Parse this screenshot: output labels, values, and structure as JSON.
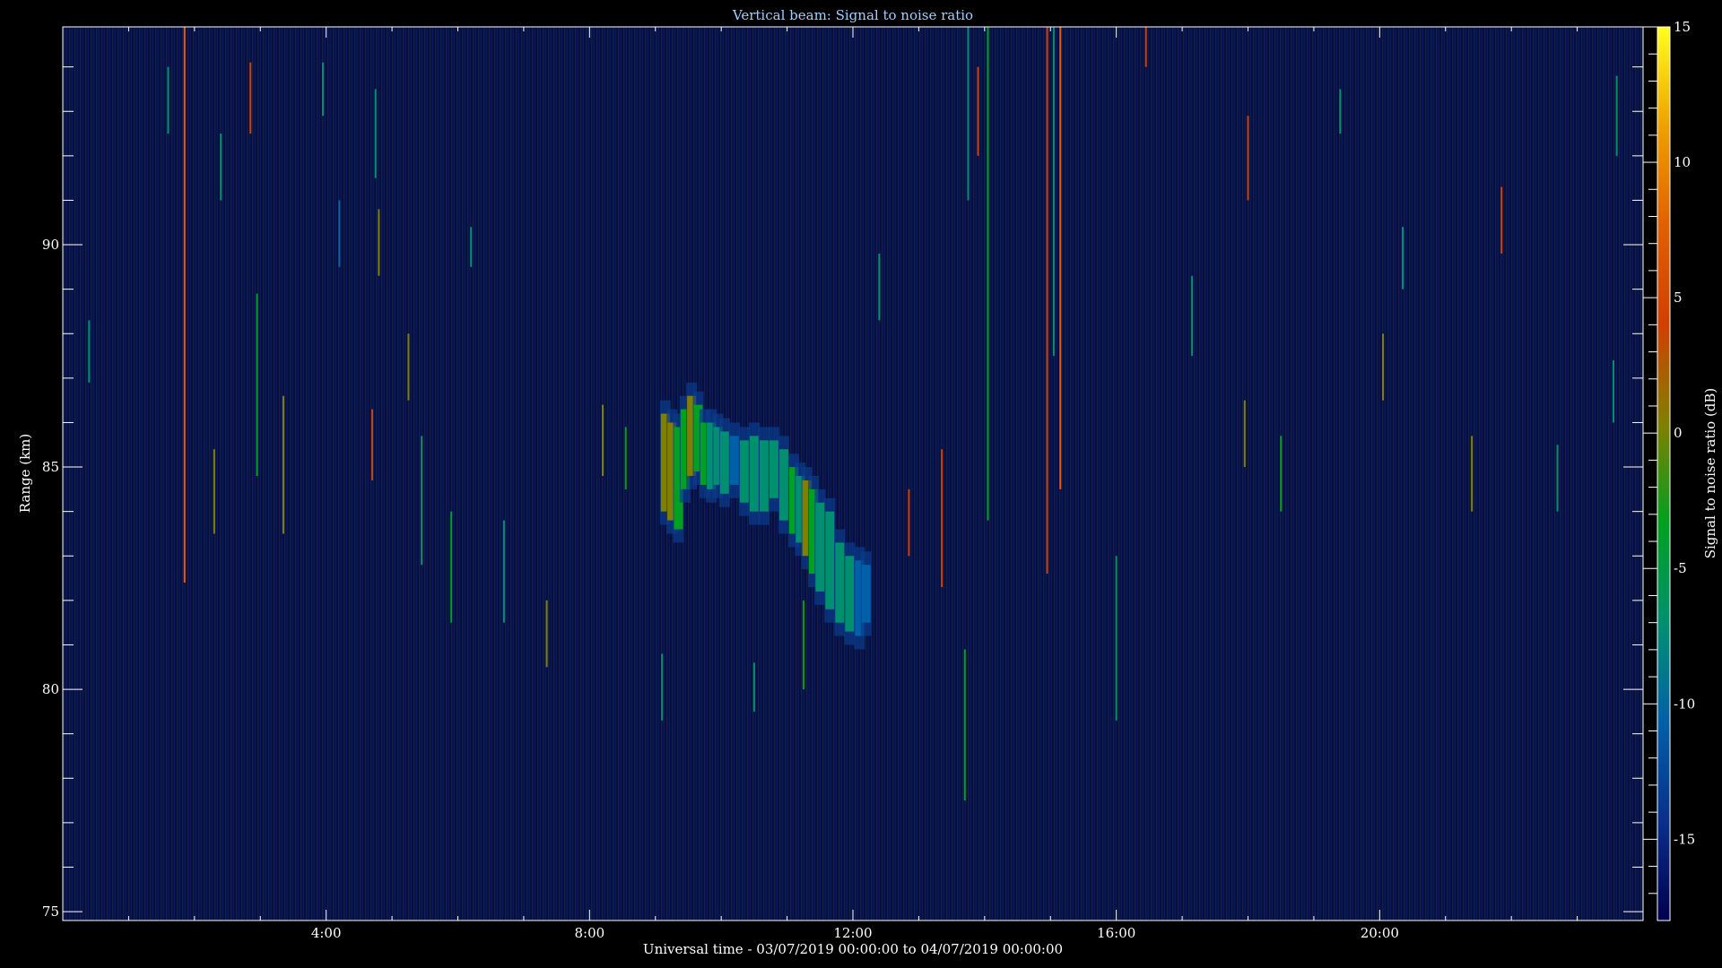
{
  "chart_data": {
    "type": "heatmap",
    "title": "Vertical beam: Signal to noise ratio",
    "xlabel": "Universal time - 03/07/2019 00:00:00 to 04/07/2019 00:00:00",
    "ylabel": "Range (km)",
    "colorbar_label": "Signal to noise ratio (dB)",
    "xlim": [
      0,
      24
    ],
    "ylim": [
      74.8,
      94.9
    ],
    "clim": [
      -18,
      15
    ],
    "x_ticks": [
      {
        "value": 4,
        "label": "4:00"
      },
      {
        "value": 8,
        "label": "8:00"
      },
      {
        "value": 12,
        "label": "12:00"
      },
      {
        "value": 16,
        "label": "16:00"
      },
      {
        "value": 20,
        "label": "20:00"
      }
    ],
    "y_ticks": [
      {
        "value": 75,
        "label": "75"
      },
      {
        "value": 80,
        "label": "80"
      },
      {
        "value": 85,
        "label": "85"
      },
      {
        "value": 90,
        "label": "90"
      }
    ],
    "colorbar_ticks": [
      {
        "value": 15,
        "label": "15"
      },
      {
        "value": 10,
        "label": "10"
      },
      {
        "value": 5,
        "label": "5"
      },
      {
        "value": 0,
        "label": "0"
      },
      {
        "value": -5,
        "label": "-5"
      },
      {
        "value": -10,
        "label": "-10"
      },
      {
        "value": -15,
        "label": "-15"
      }
    ],
    "colormap": [
      "#00004f",
      "#0a2f8c",
      "#0060a8",
      "#009070",
      "#00a020",
      "#808000",
      "#d04000",
      "#e06000",
      "#f0a000",
      "#ffff20"
    ],
    "background_color": "#0a0f3c",
    "echo_region": {
      "time_start": 9.1,
      "time_end": 12.3,
      "range_top": 86.5,
      "range_bottom": 81.2,
      "peak_snr": 2
    },
    "echo_cells": [
      {
        "t": 9.15,
        "r_top": 86.2,
        "r_bottom": 84.0,
        "snr": 1
      },
      {
        "t": 9.25,
        "r_top": 86.0,
        "r_bottom": 83.8,
        "snr": 0
      },
      {
        "t": 9.35,
        "r_top": 85.9,
        "r_bottom": 83.6,
        "snr": -4
      },
      {
        "t": 9.45,
        "r_top": 86.3,
        "r_bottom": 84.5,
        "snr": -5
      },
      {
        "t": 9.55,
        "r_top": 86.6,
        "r_bottom": 84.8,
        "snr": 1
      },
      {
        "t": 9.65,
        "r_top": 86.4,
        "r_bottom": 84.9,
        "snr": -2
      },
      {
        "t": 9.75,
        "r_top": 86.0,
        "r_bottom": 84.6,
        "snr": -5
      },
      {
        "t": 9.85,
        "r_top": 86.0,
        "r_bottom": 84.5,
        "snr": -7
      },
      {
        "t": 9.95,
        "r_top": 85.9,
        "r_bottom": 84.6,
        "snr": -7
      },
      {
        "t": 10.05,
        "r_top": 85.8,
        "r_bottom": 84.4,
        "snr": -8
      },
      {
        "t": 10.2,
        "r_top": 85.7,
        "r_bottom": 84.6,
        "snr": -9
      },
      {
        "t": 10.35,
        "r_top": 85.6,
        "r_bottom": 84.2,
        "snr": -7
      },
      {
        "t": 10.5,
        "r_top": 85.7,
        "r_bottom": 84.0,
        "snr": -8
      },
      {
        "t": 10.65,
        "r_top": 85.6,
        "r_bottom": 84.0,
        "snr": -7
      },
      {
        "t": 10.8,
        "r_top": 85.6,
        "r_bottom": 84.3,
        "snr": -6
      },
      {
        "t": 10.95,
        "r_top": 85.4,
        "r_bottom": 83.8,
        "snr": -7
      },
      {
        "t": 11.1,
        "r_top": 85.0,
        "r_bottom": 83.5,
        "snr": -5
      },
      {
        "t": 11.2,
        "r_top": 84.8,
        "r_bottom": 83.3,
        "snr": -6
      },
      {
        "t": 11.3,
        "r_top": 84.7,
        "r_bottom": 83.0,
        "snr": 1
      },
      {
        "t": 11.4,
        "r_top": 84.5,
        "r_bottom": 82.6,
        "snr": -5
      },
      {
        "t": 11.5,
        "r_top": 84.2,
        "r_bottom": 82.2,
        "snr": -6
      },
      {
        "t": 11.65,
        "r_top": 84.0,
        "r_bottom": 81.8,
        "snr": -7
      },
      {
        "t": 11.8,
        "r_top": 83.3,
        "r_bottom": 81.5,
        "snr": -6
      },
      {
        "t": 11.95,
        "r_top": 83.0,
        "r_bottom": 81.3,
        "snr": -8
      },
      {
        "t": 12.1,
        "r_top": 82.9,
        "r_bottom": 81.2,
        "snr": -9
      },
      {
        "t": 12.2,
        "r_top": 82.8,
        "r_bottom": 81.5,
        "snr": -11
      }
    ],
    "noise_streaks": [
      {
        "t": 0.4,
        "r_top": 88.3,
        "r_bottom": 86.9,
        "snr": -8
      },
      {
        "t": 1.6,
        "r_top": 94.0,
        "r_bottom": 92.5,
        "snr": -6
      },
      {
        "t": 1.85,
        "r_top": 94.9,
        "r_bottom": 82.4,
        "snr": 6
      },
      {
        "t": 2.3,
        "r_top": 85.4,
        "r_bottom": 83.5,
        "snr": 2
      },
      {
        "t": 2.4,
        "r_top": 92.5,
        "r_bottom": 91.0,
        "snr": -6
      },
      {
        "t": 2.85,
        "r_top": 94.1,
        "r_bottom": 92.5,
        "snr": 5
      },
      {
        "t": 2.95,
        "r_top": 88.9,
        "r_bottom": 84.8,
        "snr": -5
      },
      {
        "t": 3.35,
        "r_top": 86.6,
        "r_bottom": 83.5,
        "snr": 2
      },
      {
        "t": 3.95,
        "r_top": 94.1,
        "r_bottom": 92.9,
        "snr": -6
      },
      {
        "t": 4.2,
        "r_top": 91.0,
        "r_bottom": 89.5,
        "snr": -9
      },
      {
        "t": 4.7,
        "r_top": 86.3,
        "r_bottom": 84.7,
        "snr": 4
      },
      {
        "t": 4.75,
        "r_top": 93.5,
        "r_bottom": 91.5,
        "snr": -6
      },
      {
        "t": 4.8,
        "r_top": 90.8,
        "r_bottom": 89.3,
        "snr": 1
      },
      {
        "t": 5.25,
        "r_top": 88.0,
        "r_bottom": 86.5,
        "snr": 2
      },
      {
        "t": 5.45,
        "r_top": 85.7,
        "r_bottom": 82.8,
        "snr": -6
      },
      {
        "t": 5.9,
        "r_top": 84.0,
        "r_bottom": 81.5,
        "snr": -5
      },
      {
        "t": 6.2,
        "r_top": 90.4,
        "r_bottom": 89.5,
        "snr": -8
      },
      {
        "t": 6.7,
        "r_top": 83.8,
        "r_bottom": 81.5,
        "snr": -6
      },
      {
        "t": 7.35,
        "r_top": 82.0,
        "r_bottom": 80.5,
        "snr": 2
      },
      {
        "t": 8.2,
        "r_top": 86.4,
        "r_bottom": 84.8,
        "snr": 2
      },
      {
        "t": 8.55,
        "r_top": 85.9,
        "r_bottom": 84.5,
        "snr": -5
      },
      {
        "t": 9.1,
        "r_top": 80.8,
        "r_bottom": 79.3,
        "snr": -6
      },
      {
        "t": 10.5,
        "r_top": 80.6,
        "r_bottom": 79.5,
        "snr": -8
      },
      {
        "t": 11.25,
        "r_top": 82.0,
        "r_bottom": 80.0,
        "snr": -4
      },
      {
        "t": 12.4,
        "r_top": 89.8,
        "r_bottom": 88.3,
        "snr": -7
      },
      {
        "t": 12.85,
        "r_top": 84.5,
        "r_bottom": 83.0,
        "snr": 3
      },
      {
        "t": 13.35,
        "r_top": 85.4,
        "r_bottom": 82.3,
        "snr": 3
      },
      {
        "t": 13.7,
        "r_top": 80.9,
        "r_bottom": 77.5,
        "snr": -4
      },
      {
        "t": 13.75,
        "r_top": 94.9,
        "r_bottom": 91.0,
        "snr": -6
      },
      {
        "t": 13.9,
        "r_top": 94.0,
        "r_bottom": 92.0,
        "snr": 3
      },
      {
        "t": 14.05,
        "r_top": 94.9,
        "r_bottom": 83.8,
        "snr": -3
      },
      {
        "t": 14.95,
        "r_top": 94.9,
        "r_bottom": 82.6,
        "snr": 3
      },
      {
        "t": 15.05,
        "r_top": 94.9,
        "r_bottom": 87.5,
        "snr": -8
      },
      {
        "t": 15.15,
        "r_top": 94.9,
        "r_bottom": 84.5,
        "snr": 6
      },
      {
        "t": 16.0,
        "r_top": 83.0,
        "r_bottom": 79.3,
        "snr": -6
      },
      {
        "t": 16.45,
        "r_top": 94.9,
        "r_bottom": 94.0,
        "snr": 4
      },
      {
        "t": 17.15,
        "r_top": 89.3,
        "r_bottom": 87.5,
        "snr": -8
      },
      {
        "t": 17.95,
        "r_top": 86.5,
        "r_bottom": 85.0,
        "snr": 2
      },
      {
        "t": 18.0,
        "r_top": 92.9,
        "r_bottom": 91.0,
        "snr": 3
      },
      {
        "t": 18.5,
        "r_top": 85.7,
        "r_bottom": 84.0,
        "snr": -5
      },
      {
        "t": 19.4,
        "r_top": 93.5,
        "r_bottom": 92.5,
        "snr": -6
      },
      {
        "t": 20.05,
        "r_top": 88.0,
        "r_bottom": 86.5,
        "snr": 2
      },
      {
        "t": 20.35,
        "r_top": 90.4,
        "r_bottom": 89.0,
        "snr": -8
      },
      {
        "t": 21.4,
        "r_top": 85.7,
        "r_bottom": 84.0,
        "snr": 2
      },
      {
        "t": 21.85,
        "r_top": 91.3,
        "r_bottom": 89.8,
        "snr": 3
      },
      {
        "t": 22.7,
        "r_top": 85.5,
        "r_bottom": 84.0,
        "snr": -6
      },
      {
        "t": 23.55,
        "r_top": 87.4,
        "r_bottom": 86.0,
        "snr": -6
      },
      {
        "t": 23.6,
        "r_top": 93.8,
        "r_bottom": 92.0,
        "snr": -8
      }
    ]
  }
}
